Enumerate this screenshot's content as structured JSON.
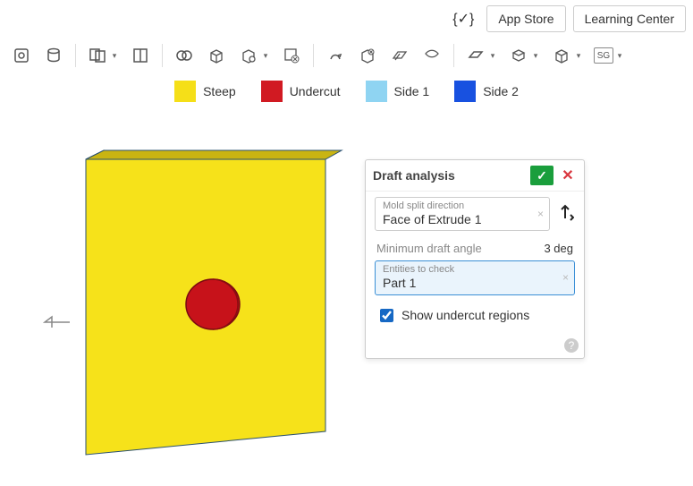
{
  "topbar": {
    "app_store": "App Store",
    "learning_center": "Learning Center"
  },
  "legend": {
    "steep": {
      "label": "Steep",
      "color": "#f5df18"
    },
    "undercut": {
      "label": "Undercut",
      "color": "#d11a22"
    },
    "side1": {
      "label": "Side 1",
      "color": "#8fd4f2"
    },
    "side2": {
      "label": "Side 2",
      "color": "#1851e0"
    }
  },
  "panel": {
    "title": "Draft analysis",
    "mold_label": "Mold split direction",
    "mold_value": "Face of Extrude 1",
    "min_angle_label": "Minimum draft angle",
    "min_angle_value": "3 deg",
    "entities_label": "Entities to check",
    "entities_value": "Part 1",
    "show_undercut_label": "Show undercut regions",
    "show_undercut_checked": true
  },
  "icons": {
    "help": "?"
  }
}
